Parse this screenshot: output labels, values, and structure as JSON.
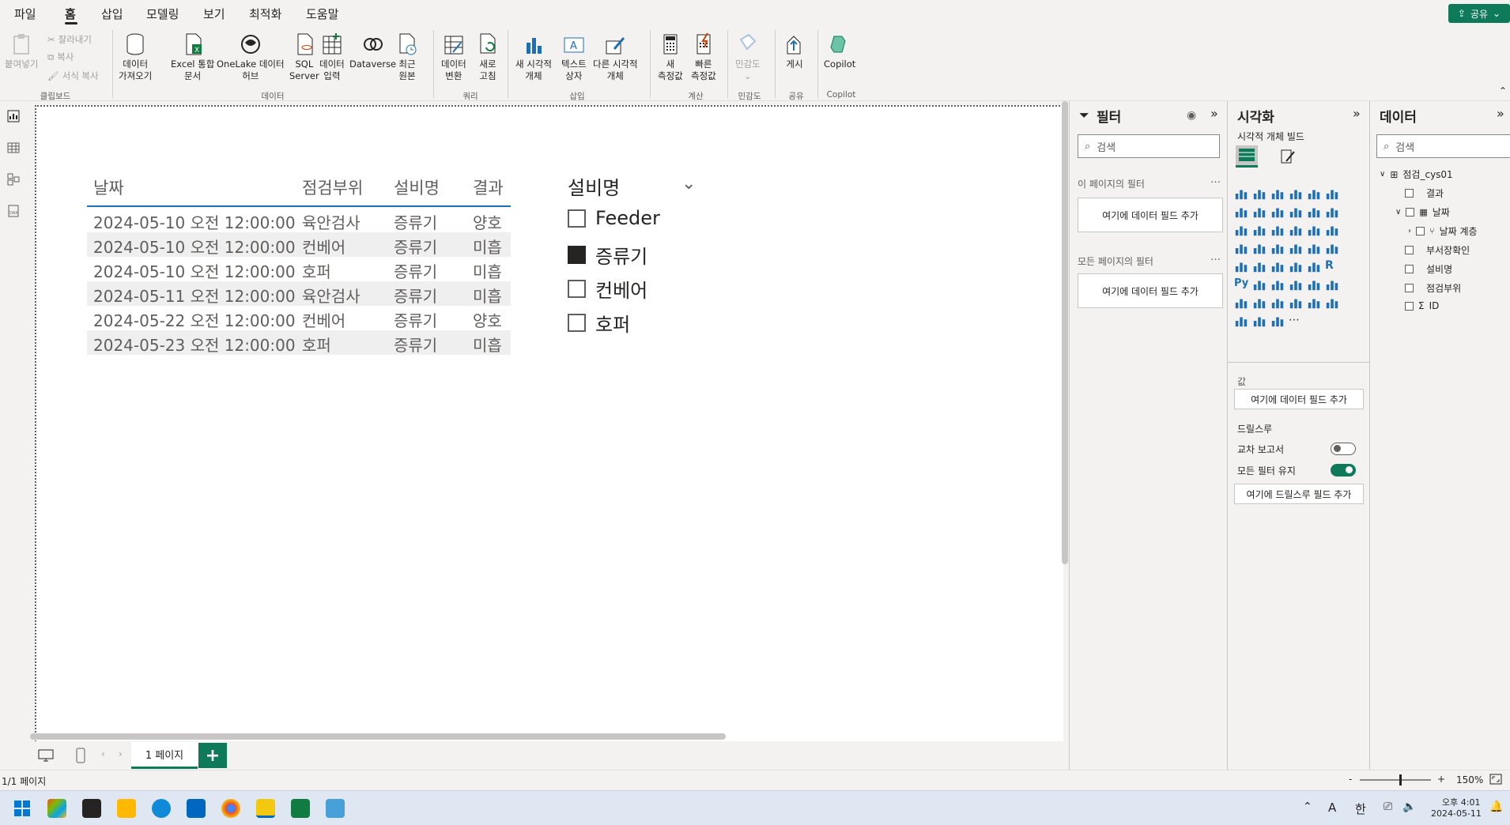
{
  "menu": {
    "items": [
      "파일",
      "홈",
      "삽입",
      "모델링",
      "보기",
      "최적화",
      "도움말"
    ],
    "active": "홈",
    "share_label": "공유"
  },
  "ribbon": {
    "clipboard": {
      "paste": "붙여넣기",
      "cut": "잘라내기",
      "copy": "복사",
      "format_copy": "서식 복사",
      "group": "클립보드"
    },
    "data": {
      "get_data": [
        "데이터",
        "가져오기"
      ],
      "excel": [
        "Excel 통합",
        "문서"
      ],
      "onelake": [
        "OneLake 데이터",
        "허브"
      ],
      "sql": [
        "SQL",
        "Server"
      ],
      "enter_data": [
        "데이터",
        "입력"
      ],
      "dataverse": "Dataverse",
      "recent": [
        "최근",
        "원본"
      ],
      "group": "데이터"
    },
    "query": {
      "transform": [
        "데이터",
        "변환"
      ],
      "refresh": [
        "새로",
        "고침"
      ],
      "group": "쿼리"
    },
    "insert": {
      "new_visual": [
        "새 시각적",
        "개체"
      ],
      "text_box": [
        "텍스트",
        "상자"
      ],
      "more_visuals": [
        "다른 시각적",
        "개체"
      ],
      "group": "삽입"
    },
    "calc": {
      "new_measure": [
        "새",
        "측정값"
      ],
      "quick_measure": [
        "빠른",
        "측정값"
      ],
      "group": "계산"
    },
    "sensitivity": {
      "label": "민감도",
      "group": "민감도"
    },
    "share": {
      "publish": "게시",
      "group": "공유"
    },
    "copilot": {
      "label": "Copilot",
      "group": "Copilot"
    }
  },
  "table_visual": {
    "headers": [
      "날짜",
      "점검부위",
      "설비명",
      "결과"
    ],
    "rows": [
      [
        "2024-05-10 오전 12:00:00",
        "육안검사",
        "증류기",
        "양호"
      ],
      [
        "2024-05-10 오전 12:00:00",
        "컨베어",
        "증류기",
        "미흡"
      ],
      [
        "2024-05-10 오전 12:00:00",
        "호퍼",
        "증류기",
        "미흡"
      ],
      [
        "2024-05-11 오전 12:00:00",
        "육안검사",
        "증류기",
        "미흡"
      ],
      [
        "2024-05-22 오전 12:00:00",
        "컨베어",
        "증류기",
        "양호"
      ],
      [
        "2024-05-23 오전 12:00:00",
        "호퍼",
        "증류기",
        "미흡"
      ]
    ]
  },
  "slicer": {
    "title": "설비명",
    "items": [
      {
        "label": "Feeder",
        "checked": false
      },
      {
        "label": "증류기",
        "checked": true
      },
      {
        "label": "컨베어",
        "checked": false
      },
      {
        "label": "호퍼",
        "checked": false
      }
    ]
  },
  "pages": {
    "tab": "1 페이지",
    "status": "1/1 페이지",
    "zoom": "150%"
  },
  "filter_pane": {
    "title": "필터",
    "search_placeholder": "검색",
    "this_page": "이 페이지의 필터",
    "all_pages": "모든 페이지의 필터",
    "add_field": "여기에 데이터 필드 추가"
  },
  "viz_pane": {
    "title": "시각화",
    "build": "시각적 개체 빌드",
    "values": "값",
    "values_drop": "여기에 데이터 필드 추가",
    "drillthrough": "드릴스루",
    "cross_report": "교차 보고서",
    "keep_filters": "모든 필터 유지",
    "drill_drop": "여기에 드릴스루 필드 추가",
    "cross_report_on": false,
    "keep_filters_on": true
  },
  "data_pane": {
    "title": "데이터",
    "search_placeholder": "검색",
    "table": "점검_cys01",
    "fields": [
      "결과",
      "날짜",
      "날짜 계층",
      "부서장확인",
      "설비명",
      "점검부위",
      "ID"
    ]
  },
  "taskbar": {
    "time": "오후 4:01",
    "date": "2024-05-11",
    "ime1": "A",
    "ime2": "한"
  },
  "colors": {
    "accent": "#0e7a5a",
    "table_line": "#1f6fb5"
  }
}
